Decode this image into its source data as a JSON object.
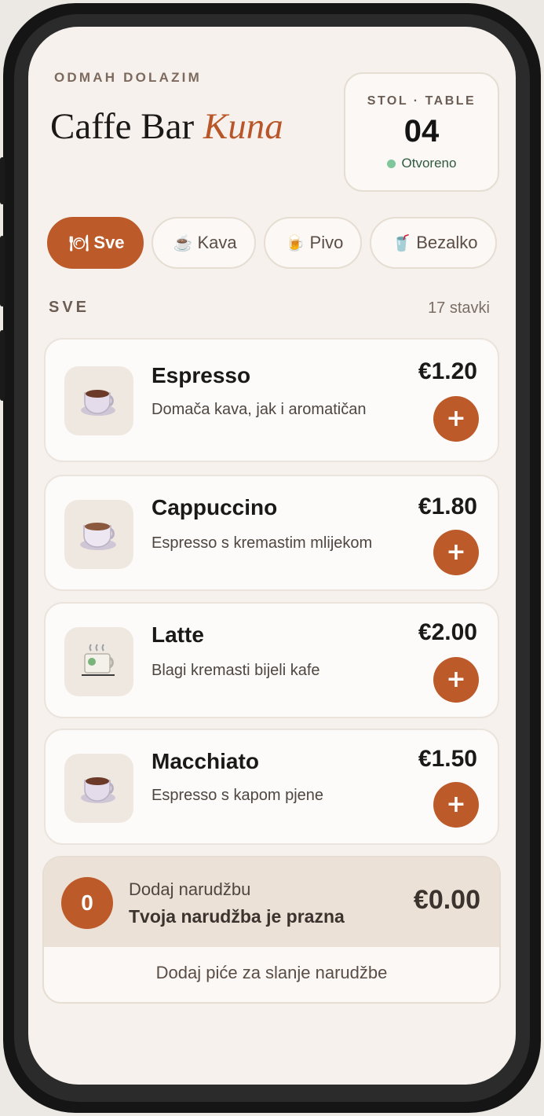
{
  "header": {
    "kicker": "ODMAH DOLAZIM",
    "title_main": "Caffe Bar ",
    "title_accent": "Kuna"
  },
  "table": {
    "label": "STOL · TABLE",
    "number": "04",
    "status": "Otvoreno",
    "status_color": "#7fc79a"
  },
  "categories": [
    {
      "label": "Sve",
      "icon": "cutlery-icon",
      "glyph": "🍽",
      "active": true
    },
    {
      "label": "Kava",
      "icon": "coffee-cup-icon",
      "glyph": "☕",
      "active": false
    },
    {
      "label": "Pivo",
      "icon": "beer-icon",
      "glyph": "🍺",
      "active": false
    },
    {
      "label": "Bezalko",
      "icon": "soft-drink-icon",
      "glyph": "🥤",
      "active": false
    }
  ],
  "section": {
    "title": "SVE",
    "count": "17 stavki"
  },
  "items": [
    {
      "name": "Espresso",
      "description": "Domača kava, jak i aromatičan",
      "price": "€1.20",
      "icon": "espresso-cup-icon",
      "add_label": "+"
    },
    {
      "name": "Cappuccino",
      "description": "Espresso s kremastim mlijekom",
      "price": "€1.80",
      "icon": "cappuccino-cup-icon",
      "add_label": "+"
    },
    {
      "name": "Latte",
      "description": "Blagi kremasti bijeli kafe",
      "price": "€2.00",
      "icon": "latte-mug-icon",
      "add_label": "+"
    },
    {
      "name": "Macchiato",
      "description": "Espresso s kapom pjene",
      "price": "€1.50",
      "icon": "macchiato-cup-icon",
      "add_label": "+"
    }
  ],
  "order": {
    "count": "0",
    "label": "Dodaj narudžbu",
    "empty_text": "Tvoja narudžba je prazna",
    "total": "€0.00",
    "hint": "Dodaj piće za slanje narudžbe"
  },
  "colors": {
    "accent": "#bd5a2a",
    "background": "#f6f1ec"
  }
}
